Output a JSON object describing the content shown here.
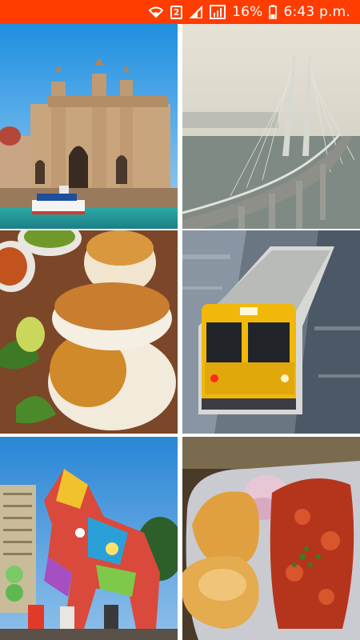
{
  "status_bar": {
    "battery_percent": "16%",
    "time": "6:43 p.m.",
    "sim_badge": "2",
    "background_color": "#ff3d00",
    "icons": [
      "wifi-icon",
      "sim-2-icon",
      "signal-icon",
      "signal-boxed-icon",
      "battery-icon"
    ]
  },
  "gallery": {
    "tiles": [
      {
        "name": "gateway-of-india-tile"
      },
      {
        "name": "sea-link-bridge-tile"
      },
      {
        "name": "vada-pav-tile"
      },
      {
        "name": "local-train-tile"
      },
      {
        "name": "horse-statue-tile"
      },
      {
        "name": "pav-bhaji-tile"
      }
    ]
  }
}
